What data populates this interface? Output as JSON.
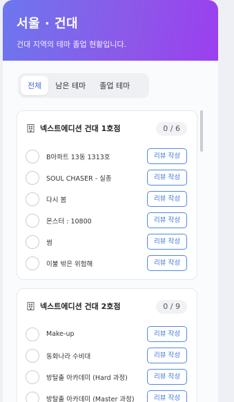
{
  "header": {
    "title": "서울 · 건대",
    "subtitle": "건대 지역의 테마 졸업 현황입니다."
  },
  "tabs": [
    {
      "label": "전체"
    },
    {
      "label": "남은 테마"
    },
    {
      "label": "졸업 테마"
    }
  ],
  "stores": [
    {
      "name": "넥스트에디션 건대 1호점",
      "progress": "0 / 6",
      "themes": [
        {
          "title": "B아파트 13동 1313호",
          "button": "리뷰 작성"
        },
        {
          "title": "SOUL CHASER - 실종",
          "button": "리뷰 작성"
        },
        {
          "title": "다시 봄",
          "button": "리뷰 작성"
        },
        {
          "title": "몬스터 : 10800",
          "button": "리뷰 작성"
        },
        {
          "title": "썸",
          "button": "리뷰 작성"
        },
        {
          "title": "이불 밖은 위험해",
          "button": "리뷰 작성"
        }
      ]
    },
    {
      "name": "넥스트에디션 건대 2호점",
      "progress": "0 / 9",
      "themes": [
        {
          "title": "Make-up",
          "button": "리뷰 작성"
        },
        {
          "title": "동화나라 수비대",
          "button": "리뷰 작성"
        },
        {
          "title": "방탈출 아카데미 (Hard 과정)",
          "button": "리뷰 작성"
        },
        {
          "title": "방탈출 아카데미 (Master 과정)",
          "button": "리뷰 작성"
        }
      ]
    }
  ]
}
